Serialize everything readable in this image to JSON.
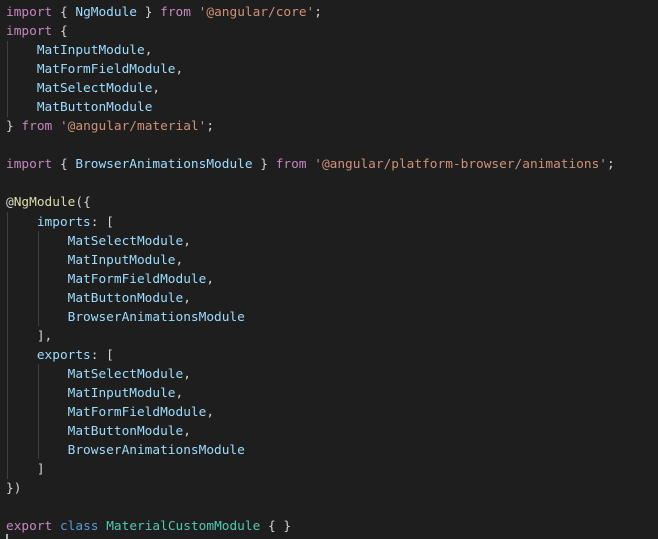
{
  "theme": {
    "background": "#1e1e1e",
    "foreground": "#d4d4d4",
    "keyword": "#c586c0",
    "type": "#4ec9b0",
    "variable": "#9cdcfe",
    "function": "#dcdcaa",
    "string": "#ce9178",
    "declaration": "#569cd6"
  },
  "lines": [
    [
      {
        "t": "import",
        "k": "keyword"
      },
      {
        "t": " { ",
        "k": "punct"
      },
      {
        "t": "NgModule",
        "k": "var"
      },
      {
        "t": " } ",
        "k": "punct"
      },
      {
        "t": "from",
        "k": "keyword"
      },
      {
        "t": " ",
        "k": "punct"
      },
      {
        "t": "'@angular/core'",
        "k": "string"
      },
      {
        "t": ";",
        "k": "punct"
      }
    ],
    [
      {
        "t": "import",
        "k": "keyword"
      },
      {
        "t": " {",
        "k": "punct"
      }
    ],
    [
      {
        "t": "    ",
        "k": "punct"
      },
      {
        "t": "MatInputModule",
        "k": "var"
      },
      {
        "t": ",",
        "k": "punct"
      }
    ],
    [
      {
        "t": "    ",
        "k": "punct"
      },
      {
        "t": "MatFormFieldModule",
        "k": "var"
      },
      {
        "t": ",",
        "k": "punct"
      }
    ],
    [
      {
        "t": "    ",
        "k": "punct"
      },
      {
        "t": "MatSelectModule",
        "k": "var"
      },
      {
        "t": ",",
        "k": "punct"
      }
    ],
    [
      {
        "t": "    ",
        "k": "punct"
      },
      {
        "t": "MatButtonModule",
        "k": "var"
      }
    ],
    [
      {
        "t": "} ",
        "k": "punct"
      },
      {
        "t": "from",
        "k": "keyword"
      },
      {
        "t": " ",
        "k": "punct"
      },
      {
        "t": "'@angular/material'",
        "k": "string"
      },
      {
        "t": ";",
        "k": "punct"
      }
    ],
    [],
    [
      {
        "t": "import",
        "k": "keyword"
      },
      {
        "t": " { ",
        "k": "punct"
      },
      {
        "t": "BrowserAnimationsModule",
        "k": "var"
      },
      {
        "t": " } ",
        "k": "punct"
      },
      {
        "t": "from",
        "k": "keyword"
      },
      {
        "t": " ",
        "k": "punct"
      },
      {
        "t": "'@angular/platform-browser/animations'",
        "k": "string"
      },
      {
        "t": ";",
        "k": "punct"
      }
    ],
    [],
    [
      {
        "t": "@",
        "k": "plain"
      },
      {
        "t": "NgModule",
        "k": "func"
      },
      {
        "t": "({",
        "k": "punct"
      }
    ],
    [
      {
        "t": "    ",
        "k": "punct"
      },
      {
        "t": "imports",
        "k": "var"
      },
      {
        "t": ": [",
        "k": "punct"
      }
    ],
    [
      {
        "t": "        ",
        "k": "punct"
      },
      {
        "t": "MatSelectModule",
        "k": "var"
      },
      {
        "t": ",",
        "k": "punct"
      }
    ],
    [
      {
        "t": "        ",
        "k": "punct"
      },
      {
        "t": "MatInputModule",
        "k": "var"
      },
      {
        "t": ",",
        "k": "punct"
      }
    ],
    [
      {
        "t": "        ",
        "k": "punct"
      },
      {
        "t": "MatFormFieldModule",
        "k": "var"
      },
      {
        "t": ",",
        "k": "punct"
      }
    ],
    [
      {
        "t": "        ",
        "k": "punct"
      },
      {
        "t": "MatButtonModule",
        "k": "var"
      },
      {
        "t": ",",
        "k": "punct"
      }
    ],
    [
      {
        "t": "        ",
        "k": "punct"
      },
      {
        "t": "BrowserAnimationsModule",
        "k": "var"
      }
    ],
    [
      {
        "t": "    ],",
        "k": "punct"
      }
    ],
    [
      {
        "t": "    ",
        "k": "punct"
      },
      {
        "t": "exports",
        "k": "var"
      },
      {
        "t": ": [",
        "k": "punct"
      }
    ],
    [
      {
        "t": "        ",
        "k": "punct"
      },
      {
        "t": "MatSelectModule",
        "k": "var"
      },
      {
        "t": ",",
        "k": "punct"
      }
    ],
    [
      {
        "t": "        ",
        "k": "punct"
      },
      {
        "t": "MatInputModule",
        "k": "var"
      },
      {
        "t": ",",
        "k": "punct"
      }
    ],
    [
      {
        "t": "        ",
        "k": "punct"
      },
      {
        "t": "MatFormFieldModule",
        "k": "var"
      },
      {
        "t": ",",
        "k": "punct"
      }
    ],
    [
      {
        "t": "        ",
        "k": "punct"
      },
      {
        "t": "MatButtonModule",
        "k": "var"
      },
      {
        "t": ",",
        "k": "punct"
      }
    ],
    [
      {
        "t": "        ",
        "k": "punct"
      },
      {
        "t": "BrowserAnimationsModule",
        "k": "var"
      }
    ],
    [
      {
        "t": "    ]",
        "k": "punct"
      }
    ],
    [
      {
        "t": "})",
        "k": "punct"
      }
    ],
    [],
    [
      {
        "t": "export",
        "k": "keyword"
      },
      {
        "t": " ",
        "k": "punct"
      },
      {
        "t": "class",
        "k": "decl"
      },
      {
        "t": " ",
        "k": "punct"
      },
      {
        "t": "MaterialCustomModule",
        "k": "type"
      },
      {
        "t": " { }",
        "k": "punct"
      }
    ]
  ]
}
